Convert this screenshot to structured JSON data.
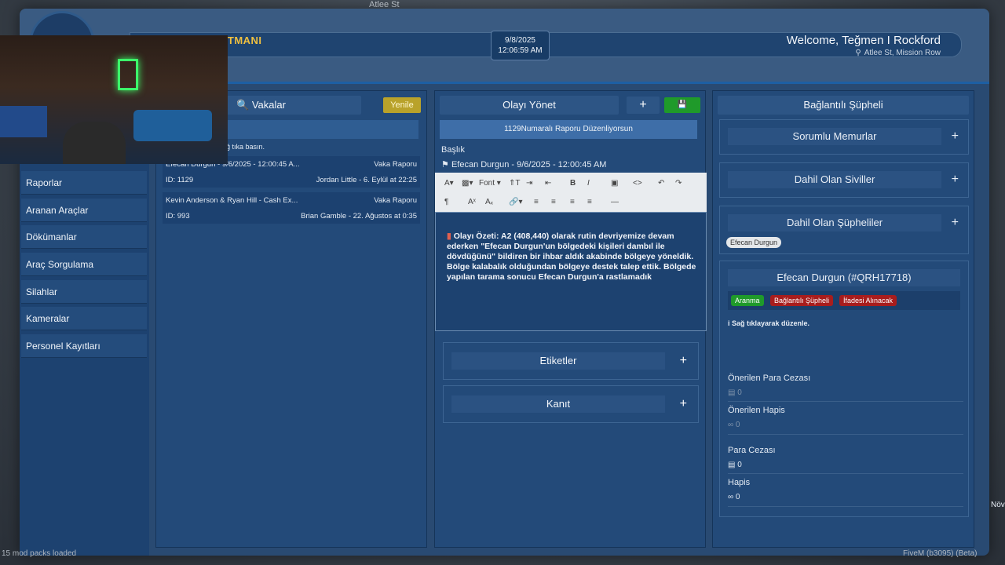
{
  "game_overlay": {
    "street_top": "Atlee St",
    "mod_packs": "15 mod packs loaded",
    "fivem_build": "FiveM (b3095) (Beta)",
    "right_partial": "Növ"
  },
  "header": {
    "dept_title_partial": "RTMANI",
    "date": "9/8/2025",
    "time": "12:06:59 AM",
    "welcome": "Welcome, Teğmen I Rockford",
    "location": "Atlee St, Mission Row"
  },
  "sidebar": {
    "items": [
      {
        "label": "Raporlar"
      },
      {
        "label": "Aranan Araçlar"
      },
      {
        "label": "Dökümanlar"
      },
      {
        "label": "Araç Sorgulama"
      },
      {
        "label": "Silahlar"
      },
      {
        "label": "Kameralar"
      },
      {
        "label": "Personel Kayıtları"
      }
    ]
  },
  "cases": {
    "title": "Vakalar",
    "refresh_label": "Yenile",
    "hint": "ağ tıka basın.",
    "items": [
      {
        "title": "Efecan Durgun - 9/6/2025 - 12:00:45 A...",
        "type": "Vaka Raporu",
        "id": "ID: 1129",
        "meta": "Jordan Little - 6. Eylül at 22:25"
      },
      {
        "title": "Kevin Anderson & Ryan Hill - Cash Ex...",
        "type": "Vaka Raporu",
        "id": "ID: 993",
        "meta": "Brian Gamble - 22. Ağustos at 0:35"
      }
    ]
  },
  "incident": {
    "title": "Olayı Yönet",
    "add_label": "+",
    "editing_notice": "1129Numaralı Raporu Düzenliyorsun",
    "heading_label": "Başlık",
    "heading_value": "Efecan Durgun  - 9/6/2025 - 12:00:45 AM",
    "toolbar": {
      "font": "Font",
      "separator": "—"
    },
    "body": "Olayı Özeti: A2 (408,440) olarak rutin devriyemize devam ederken \"Efecan Durgun'un bölgedeki kişileri dambıl ile dövdüğünü\" bildiren bir ihbar aldık akabinde bölgeye yöneldik. Bölge kalabalık olduğundan bölgeye destek talep ettik. Bölgede yapılan tarama sonucu Efecan Durgun'a rastlamadık",
    "tags_label": "Etiketler",
    "evidence_label": "Kanıt"
  },
  "linked": {
    "title": "Bağlantılı Şüpheli",
    "officers_label": "Sorumlu Memurlar",
    "civilians_label": "Dahil Olan Siviller",
    "suspects_label": "Dahil Olan Şüpheliler",
    "suspect_chip": "Efecan Durgun",
    "suspect_name": "Efecan Durgun (#QRH17718)",
    "tags": [
      {
        "label": "Aranma",
        "color": "#1f9a2a"
      },
      {
        "label": "Bağlantılı Şüpheli",
        "color": "#a81d1d"
      },
      {
        "label": "İfadesi Alınacak",
        "color": "#a81d1d"
      }
    ],
    "edit_hint": "i Sağ tıklayarak düzenle.",
    "recommended_fine_label": "Önerilen Para Cezası",
    "recommended_fine_value": "0",
    "recommended_jail_label": "Önerilen Hapis",
    "recommended_jail_value": "0",
    "fine_label": "Para Cezası",
    "fine_value": "0",
    "jail_label": "Hapis",
    "jail_value": "0"
  }
}
